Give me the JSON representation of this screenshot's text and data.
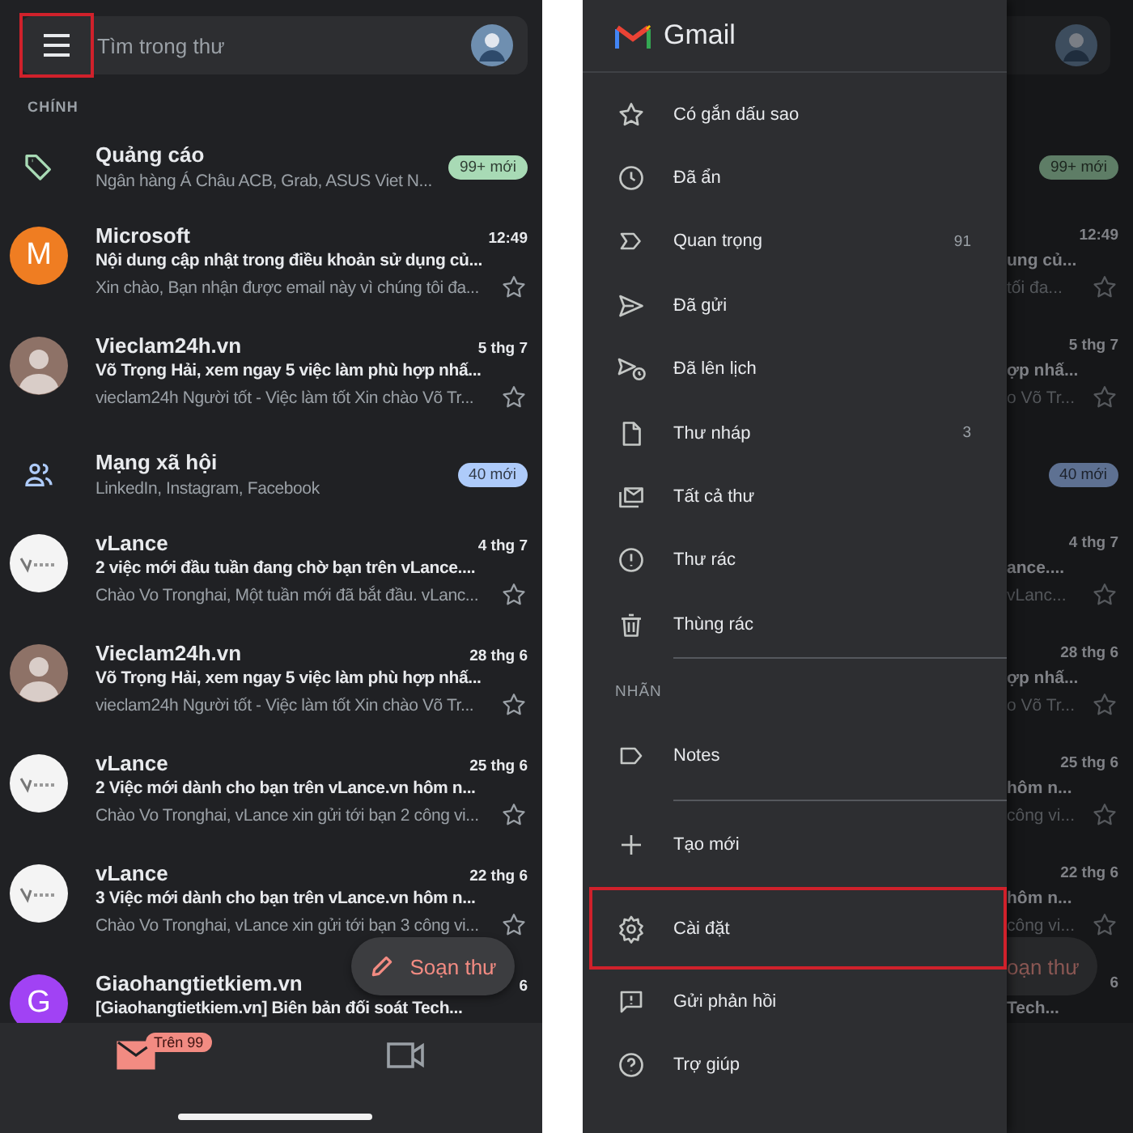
{
  "inbox": {
    "menu_button": {
      "highlighted": true
    },
    "search": {
      "placeholder": "Tìm trong thư"
    },
    "section_label": "CHÍNH",
    "rows": [
      {
        "kind": "promotions",
        "title": "Quảng cáo",
        "summary": "Ngân hàng Á Châu ACB, Grab, ASUS Viet N...",
        "badge": "99+ mới",
        "color": "#a8dab5"
      },
      {
        "kind": "email",
        "avatar": {
          "kind": "letter",
          "initial": "M",
          "color": "#ef7d22"
        },
        "sender": "Microsoft",
        "time": "12:49",
        "subject": "Nội dung cập nhật trong điều khoản sử dụng củ...",
        "snippet": "Xin chào, Bạn nhận được email này vì chúng tôi đa..."
      },
      {
        "kind": "email",
        "avatar": {
          "kind": "person"
        },
        "sender": "Vieclam24h.vn",
        "time": "5 thg 7",
        "subject": "Võ Trọng Hải, xem ngay 5 việc làm phù hợp nhấ...",
        "snippet": "vieclam24h Người tốt - Việc làm tốt Xin chào Võ Tr..."
      },
      {
        "kind": "social",
        "title": "Mạng xã hội",
        "summary": "LinkedIn, Instagram, Facebook",
        "badge": "40 mới",
        "color": "#aecbfa"
      },
      {
        "kind": "email",
        "avatar": {
          "kind": "logo"
        },
        "sender": "vLance",
        "time": "4 thg 7",
        "subject": "2 việc mới đầu tuần đang chờ bạn trên vLance....",
        "snippet": "Chào Vo Tronghai, Một tuần mới đã bắt đầu. vLanc..."
      },
      {
        "kind": "email",
        "avatar": {
          "kind": "person"
        },
        "sender": "Vieclam24h.vn",
        "time": "28 thg 6",
        "subject": "Võ Trọng Hải, xem ngay 5 việc làm phù hợp nhấ...",
        "snippet": "vieclam24h Người tốt - Việc làm tốt Xin chào Võ Tr..."
      },
      {
        "kind": "email",
        "avatar": {
          "kind": "logo"
        },
        "sender": "vLance",
        "time": "25 thg 6",
        "subject": "2 Việc mới dành cho bạn trên vLance.vn hôm n...",
        "snippet": "Chào Vo Tronghai, vLance xin gửi tới bạn 2 công vi..."
      },
      {
        "kind": "email",
        "avatar": {
          "kind": "logo"
        },
        "sender": "vLance",
        "time": "22 thg 6",
        "subject": "3 Việc mới dành cho bạn trên vLance.vn hôm n...",
        "snippet": "Chào Vo Tronghai, vLance xin gửi tới bạn 3 công vi..."
      },
      {
        "kind": "email",
        "avatar": {
          "kind": "letter",
          "initial": "G",
          "color": "#a142f4"
        },
        "sender": "Giaohangtietkiem.vn",
        "time": "6",
        "subject": "[Giaohangtietkiem.vn] Biên bản đối soát Tech..."
      }
    ],
    "compose": "Soạn thư",
    "bottom_nav": [
      {
        "kind": "mail",
        "selected": true,
        "badge": "Trên 99"
      },
      {
        "kind": "video",
        "selected": false
      }
    ]
  },
  "drawer": {
    "title": "Gmail",
    "items": [
      {
        "label": "Có gắn dấu sao"
      },
      {
        "label": "Đã ẩn"
      },
      {
        "label": "Quan trọng",
        "count": "91"
      },
      {
        "label": "Đã gửi"
      },
      {
        "label": "Đã lên lịch"
      },
      {
        "label": "Thư nháp",
        "count": "3"
      },
      {
        "label": "Tất cả thư"
      },
      {
        "label": "Thư rác"
      },
      {
        "label": "Thùng rác"
      }
    ],
    "labels_heading": "NHÃN",
    "labels": [
      {
        "label": "Notes"
      }
    ],
    "actions": [
      {
        "label": "Tạo mới",
        "highlighted": false
      },
      {
        "label": "Cài đặt",
        "highlighted": true
      },
      {
        "label": "Gửi phản hồi",
        "highlighted": false
      },
      {
        "label": "Trợ giúp",
        "highlighted": false
      }
    ]
  },
  "dimmed_inbox": {
    "rows": [
      {
        "kind": "promotions",
        "badge": "99+ mới",
        "color": "#5e7d66"
      },
      {
        "kind": "email",
        "time": "12:49",
        "subject": "ung củ...",
        "snippet": "tối đa..."
      },
      {
        "kind": "email",
        "time": "5 thg 7",
        "subject": "ợp nhấ...",
        "snippet": "o Võ Tr..."
      },
      {
        "kind": "social",
        "badge": "40 mới",
        "color": "#5e7192"
      },
      {
        "kind": "email",
        "time": "4 thg 7",
        "subject": "ance....",
        "snippet": "vLanc..."
      },
      {
        "kind": "email",
        "time": "28 thg 6",
        "subject": "ợp nhấ...",
        "snippet": "o Võ Tr..."
      },
      {
        "kind": "email",
        "time": "25 thg 6",
        "subject": "hôm n...",
        "snippet": "công vi..."
      },
      {
        "kind": "email",
        "time": "22 thg 6",
        "subject": "hôm n...",
        "snippet": "công vi..."
      },
      {
        "kind": "email",
        "time": "6",
        "subject": "Tech..."
      }
    ],
    "compose": "oạn thư"
  }
}
